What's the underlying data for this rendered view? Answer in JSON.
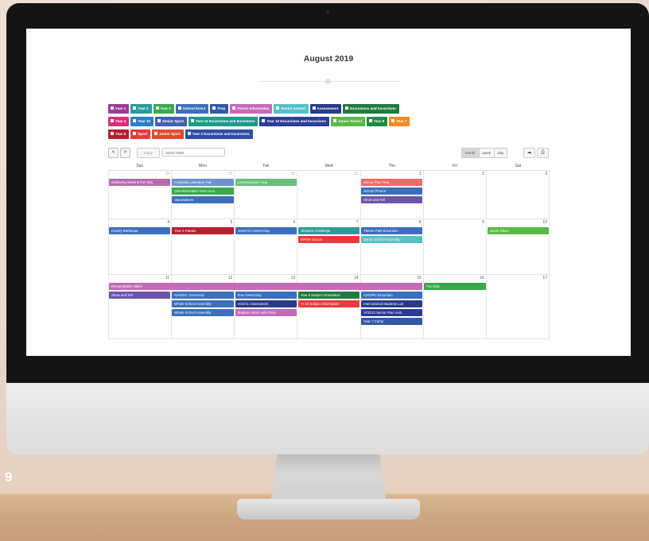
{
  "page_number": "9",
  "calendar": {
    "title": "August 2019",
    "filters": [
      [
        {
          "label": "Year 1",
          "color": "#9c3b93"
        },
        {
          "label": "Year 2",
          "color": "#2a9c9a"
        },
        {
          "label": "Year 3",
          "color": "#39a84b"
        },
        {
          "label": "School Event",
          "color": "#3c6fbc"
        },
        {
          "label": "Prep",
          "color": "#3258a8"
        },
        {
          "label": "Parent Information",
          "color": "#c56ab8"
        },
        {
          "label": "Senior School",
          "color": "#55c1c6"
        },
        {
          "label": "Assessment",
          "color": "#2a3a8c"
        },
        {
          "label": "Excursions and Incursions",
          "color": "#1f7a3c"
        }
      ],
      [
        {
          "label": "Year 4",
          "color": "#d8307d"
        },
        {
          "label": "Year 10",
          "color": "#2c7fc4"
        },
        {
          "label": "Senior Sport",
          "color": "#4461b0"
        },
        {
          "label": "Year 11 Excursions and Incursions",
          "color": "#1e9a8a"
        },
        {
          "label": "Year 10 Excursions and Incursions",
          "color": "#2a3f95"
        },
        {
          "label": "Junior School",
          "color": "#58b947"
        },
        {
          "label": "Year 8",
          "color": "#1f8a44"
        },
        {
          "label": "Year 7",
          "color": "#f08a24"
        }
      ],
      [
        {
          "label": "Year 6",
          "color": "#b3202f"
        },
        {
          "label": "Sport",
          "color": "#e83a3a"
        },
        {
          "label": "Junior Sport",
          "color": "#e0492f"
        },
        {
          "label": "Year 2 Excursions and Incursions",
          "color": "#2e4da3"
        }
      ]
    ],
    "toolbar": {
      "prev": "<",
      "next": ">",
      "today": "today",
      "date_placeholder": "Select Date",
      "views": [
        "month",
        "week",
        "day"
      ],
      "active_view": "month",
      "cloud_icon": "cloud-icon",
      "print_icon": "print-icon"
    },
    "weekdays": [
      "Sun",
      "Mon",
      "Tue",
      "Wed",
      "Thu",
      "Fri",
      "Sat"
    ],
    "weeks": [
      {
        "days": [
          {
            "n": "28",
            "other": true
          },
          {
            "n": "29",
            "other": true
          },
          {
            "n": "30",
            "other": true
          },
          {
            "n": "31",
            "other": true
          },
          {
            "n": "1"
          },
          {
            "n": "2"
          },
          {
            "n": "3"
          }
        ],
        "events": [
          {
            "col": 0,
            "span": 1,
            "slot": 0,
            "label": "Wellbeing Week & Fun Day",
            "color": "#9c3b93",
            "faded": true
          },
          {
            "col": 1,
            "span": 1,
            "slot": 0,
            "label": "Celebrate Literature Fair",
            "color": "#3c6fbc",
            "faded": true
          },
          {
            "col": 2,
            "span": 1,
            "slot": 0,
            "label": "Lost Excursion Year",
            "color": "#39a84b",
            "faded": true
          },
          {
            "col": 4,
            "span": 1,
            "slot": 0,
            "label": "Senior Prac Year",
            "color": "#e83a3a",
            "faded": true
          },
          {
            "col": 1,
            "span": 1,
            "slot": 1,
            "label": "Old McDonald's Farm Incu",
            "color": "#39a84b"
          },
          {
            "col": 4,
            "span": 1,
            "slot": 1,
            "label": "School Photos",
            "color": "#3c6fbc"
          },
          {
            "col": 1,
            "span": 1,
            "slot": 2,
            "label": "Vaccinations",
            "color": "#3c6fbc"
          },
          {
            "col": 4,
            "span": 1,
            "slot": 2,
            "label": "Show and Tell",
            "color": "#6a55a8"
          }
        ]
      },
      {
        "days": [
          {
            "n": "4"
          },
          {
            "n": "5"
          },
          {
            "n": "6"
          },
          {
            "n": "7"
          },
          {
            "n": "8"
          },
          {
            "n": "9"
          },
          {
            "n": "10"
          }
        ],
        "events": [
          {
            "col": 0,
            "span": 1,
            "slot": 0,
            "label": "Charity Barbeque",
            "color": "#3c6fbc"
          },
          {
            "col": 1,
            "span": 1,
            "slot": 0,
            "label": "Year 6 Parade",
            "color": "#b3202f"
          },
          {
            "col": 2,
            "span": 1,
            "slot": 0,
            "label": "Jeans for Genes Day",
            "color": "#3c6fbc"
          },
          {
            "col": 3,
            "span": 1,
            "slot": 0,
            "label": "Obstacle Challenge",
            "color": "#2a9c9a"
          },
          {
            "col": 4,
            "span": 1,
            "slot": 0,
            "label": "Theme Park Excursion",
            "color": "#3c6fbc"
          },
          {
            "col": 6,
            "span": 1,
            "slot": 0,
            "label": "Junior Disco",
            "color": "#58b947"
          },
          {
            "col": 3,
            "span": 1,
            "slot": 1,
            "label": "WPSR Soccer",
            "color": "#e83a3a"
          },
          {
            "col": 4,
            "span": 1,
            "slot": 1,
            "label": "Senior School Assembly",
            "color": "#55c1c6"
          }
        ]
      },
      {
        "days": [
          {
            "n": "11"
          },
          {
            "n": "12"
          },
          {
            "n": "13"
          },
          {
            "n": "14"
          },
          {
            "n": "15"
          },
          {
            "n": "16"
          },
          {
            "n": "17"
          }
        ],
        "events": [
          {
            "col": 0,
            "span": 5,
            "slot": 0,
            "label": "Reconciliation Week",
            "color": "#c56ab8"
          },
          {
            "col": 5,
            "span": 1,
            "slot": 0,
            "label": "Fun Day",
            "color": "#39a84b"
          },
          {
            "col": 0,
            "span": 1,
            "slot": 1,
            "label": "Show and Tell",
            "color": "#6a55a8"
          },
          {
            "col": 1,
            "span": 1,
            "slot": 1,
            "label": "NAIDOC Ceremony",
            "color": "#3c6fbc"
          },
          {
            "col": 2,
            "span": 1,
            "slot": 1,
            "label": "Free Dress Day",
            "color": "#3c6fbc"
          },
          {
            "col": 3,
            "span": 1,
            "slot": 1,
            "label": "Year 6 Subject Orientation",
            "color": "#1f7a3c"
          },
          {
            "col": 4,
            "span": 1,
            "slot": 1,
            "label": "CEO/PC Excursion",
            "color": "#3c6fbc"
          },
          {
            "col": 1,
            "span": 1,
            "slot": 2,
            "label": "Whole School Assembly",
            "color": "#3c6fbc"
          },
          {
            "col": 2,
            "span": 1,
            "slot": 2,
            "label": "VCE/11 Assessment",
            "color": "#2a3a8c"
          },
          {
            "col": 3,
            "span": 1,
            "slot": 2,
            "label": "Yr 10 Subject Information",
            "color": "#e83a3a"
          },
          {
            "col": 4,
            "span": 1,
            "slot": 2,
            "label": "International Students Lun",
            "color": "#2a3a8c"
          },
          {
            "col": 1,
            "span": 1,
            "slot": 3,
            "label": "Whole School Assembly",
            "color": "#3c6fbc"
          },
          {
            "col": 2,
            "span": 1,
            "slot": 3,
            "label": "Student Lunch with Princi",
            "color": "#c56ab8"
          },
          {
            "col": 4,
            "span": 1,
            "slot": 3,
            "label": "VCE/12 Senior Prac Asst",
            "color": "#2a3a8c"
          },
          {
            "col": 4,
            "span": 1,
            "slot": 4,
            "label": "Year 7 Camp",
            "color": "#3258a8"
          }
        ]
      }
    ]
  }
}
